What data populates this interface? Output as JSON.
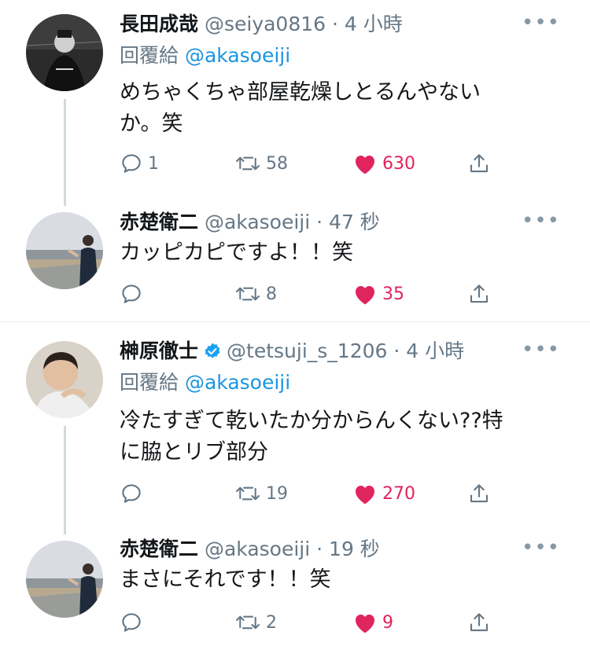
{
  "tweets": [
    {
      "name": "長田成哉",
      "handle": "@seiya0816",
      "time": "4 小時",
      "reply_prefix": "回覆給",
      "reply_to": "@akasoeiji",
      "text_lines": [
        "めちゃくちゃ部屋乾燥しとるんやない",
        "か。笑"
      ],
      "replies": "1",
      "retweets": "58",
      "likes": "630"
    },
    {
      "name": "赤楚衛二",
      "handle": "@akasoeiji",
      "time": "47 秒",
      "text_lines": [
        "カッピカピですよ！！笑"
      ],
      "replies": "",
      "retweets": "8",
      "likes": "35"
    },
    {
      "name": "榊原徹士",
      "handle": "@tetsuji_s_1206",
      "time": "4 小時",
      "verified": true,
      "reply_prefix": "回覆給",
      "reply_to": "@akasoeiji",
      "text_lines": [
        "冷たすぎて乾いたか分からんくない??特",
        "に脇とリブ部分"
      ],
      "replies": "",
      "retweets": "19",
      "likes": "270"
    },
    {
      "name": "赤楚衛二",
      "handle": "@akasoeiji",
      "time": "19 秒",
      "text_lines": [
        "まさにそれです！！笑"
      ],
      "replies": "",
      "retweets": "2",
      "likes": "9"
    }
  ],
  "separator": "·",
  "more_glyph": "•••",
  "colors": {
    "like": "#e0245e",
    "link": "#1b95e0",
    "muted": "#657786",
    "verified": "#1da1f2"
  },
  "icons": {
    "reply": "reply-icon",
    "retweet": "retweet-icon",
    "like": "heart-icon",
    "share": "share-icon",
    "verified": "verified-badge-icon",
    "more": "more-icon"
  }
}
